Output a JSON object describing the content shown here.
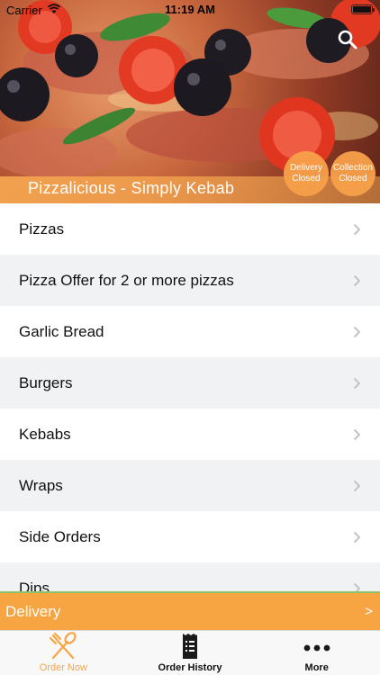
{
  "status_bar": {
    "carrier": "Carrier",
    "time": "11:19 AM"
  },
  "header": {
    "shop_title": "Pizzalicious - Simply Kebab",
    "delivery_status": {
      "line1": "Delivery",
      "line2": "Closed"
    },
    "collection_status": {
      "line1": "Collection",
      "line2": "Closed"
    },
    "search_icon": "search-icon"
  },
  "menu": {
    "items": [
      {
        "label": "Pizzas"
      },
      {
        "label": "Pizza Offer for 2 or more pizzas"
      },
      {
        "label": "Garlic Bread"
      },
      {
        "label": "Burgers"
      },
      {
        "label": "Kebabs"
      },
      {
        "label": "Wraps"
      },
      {
        "label": "Side Orders"
      },
      {
        "label": "Dips"
      }
    ]
  },
  "order_bar": {
    "mode_label": "Delivery",
    "arrow": ">"
  },
  "tab_bar": {
    "tabs": [
      {
        "label": "Order Now",
        "icon": "fork-spoon-icon",
        "active": true
      },
      {
        "label": "Order History",
        "icon": "receipt-icon",
        "active": false
      },
      {
        "label": "More",
        "icon": "more-dots-icon",
        "active": false
      }
    ]
  },
  "colors": {
    "accent": "#f7a443",
    "divider_green": "#8fc26a",
    "row_alt": "#f1f2f4"
  }
}
